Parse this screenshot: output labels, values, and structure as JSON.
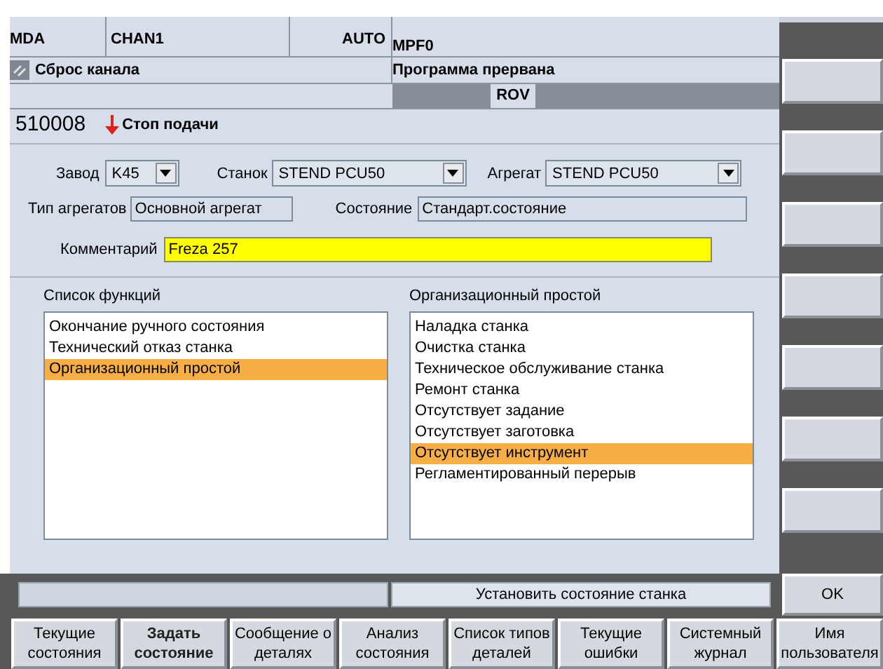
{
  "header": {
    "mode": "MDA",
    "channel": "CHAN1",
    "operation": "AUTO",
    "program": "MPF0",
    "channel_status": "Сброс канала",
    "program_status": "Программа прервана",
    "override": "ROV"
  },
  "alarm": {
    "number": "510008",
    "message": "Стоп подачи"
  },
  "form": {
    "plant_label": "Завод",
    "plant": "K45",
    "machine_label": "Станок",
    "machine": "STEND PCU50",
    "unit_label": "Агрегат",
    "unit": "STEND PCU50",
    "unit_type_label": "Тип агрегатов",
    "unit_type": "Основной агрегат",
    "state_label": "Состояние",
    "state": "Стандарт.состояние",
    "comment_label": "Комментарий",
    "comment": "Freza 257"
  },
  "function_list": {
    "title": "Список функций",
    "items": [
      {
        "label": "Окончание ручного состояния",
        "selected": false
      },
      {
        "label": "Технический отказ станка",
        "selected": false
      },
      {
        "label": "Организационный простой",
        "selected": true
      }
    ]
  },
  "downtime_list": {
    "title": "Организационный простой",
    "items": [
      {
        "label": "Наладка станка",
        "selected": false
      },
      {
        "label": "Очистка станка",
        "selected": false
      },
      {
        "label": "Техническое обслуживание станка",
        "selected": false
      },
      {
        "label": "Ремонт станка",
        "selected": false
      },
      {
        "label": "Отсутствует задание",
        "selected": false
      },
      {
        "label": "Отсутствует заготовка",
        "selected": false
      },
      {
        "label": "Отсутствует инструмент",
        "selected": true
      },
      {
        "label": "Регламентированный перерыв",
        "selected": false
      }
    ]
  },
  "status_bar": {
    "message": "Установить состояние станка"
  },
  "ok_button": "OK",
  "softkeys": [
    {
      "label": "Текущие\nсостояния",
      "selected": false
    },
    {
      "label": "Задать\nсостояние",
      "selected": true
    },
    {
      "label": "Сообщение о\nдеталях",
      "selected": false
    },
    {
      "label": "Анализ\nсостояния",
      "selected": false
    },
    {
      "label": "Список типов\nдеталей",
      "selected": false
    },
    {
      "label": "Текущие\nошибки",
      "selected": false
    },
    {
      "label": "Системный\nжурнал",
      "selected": false
    },
    {
      "label": "Имя\nпользователя",
      "selected": false
    }
  ]
}
